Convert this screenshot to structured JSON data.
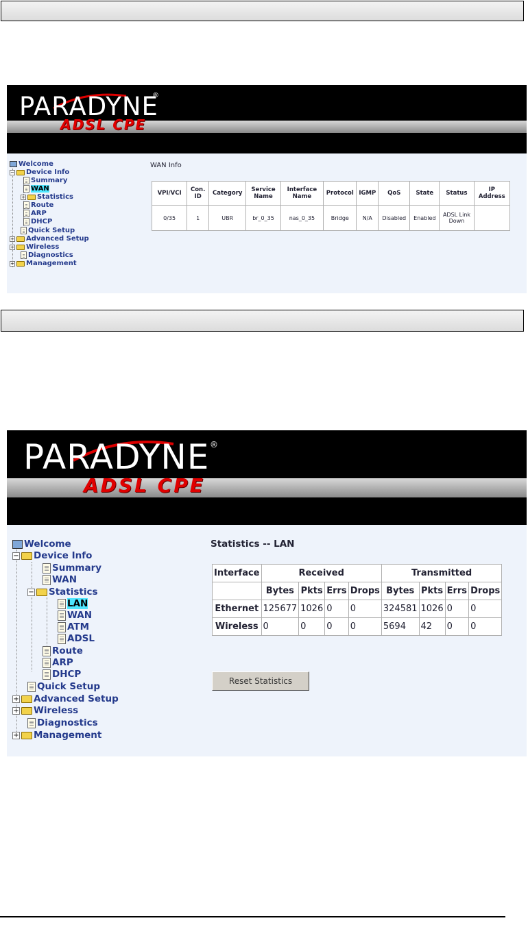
{
  "screens": [
    {
      "brand": "PARADYNE",
      "product": "ADSL CPE",
      "tree": [
        {
          "label": "Welcome"
        },
        {
          "label": "Device Info"
        },
        {
          "label": "Summary"
        },
        {
          "label": "WAN"
        },
        {
          "label": "Statistics"
        },
        {
          "label": "Route"
        },
        {
          "label": "ARP"
        },
        {
          "label": "DHCP"
        },
        {
          "label": "Quick Setup"
        },
        {
          "label": "Advanced Setup"
        },
        {
          "label": "Wireless"
        },
        {
          "label": "Diagnostics"
        },
        {
          "label": "Management"
        }
      ],
      "page_title": "WAN Info",
      "table": {
        "headers": [
          "VPI/VCI",
          "Con. ID",
          "Category",
          "Service Name",
          "Interface Name",
          "Protocol",
          "IGMP",
          "QoS",
          "State",
          "Status",
          "IP Address"
        ],
        "rows": [
          [
            "0/35",
            "1",
            "UBR",
            "br_0_35",
            "nas_0_35",
            "Bridge",
            "N/A",
            "Disabled",
            "Enabled",
            "ADSL Link Down",
            ""
          ]
        ]
      }
    },
    {
      "brand": "PARADYNE",
      "product": "ADSL CPE",
      "tree": [
        {
          "label": "Welcome"
        },
        {
          "label": "Device Info"
        },
        {
          "label": "Summary"
        },
        {
          "label": "WAN"
        },
        {
          "label": "Statistics"
        },
        {
          "label": "LAN"
        },
        {
          "label": "WAN"
        },
        {
          "label": "ATM"
        },
        {
          "label": "ADSL"
        },
        {
          "label": "Route"
        },
        {
          "label": "ARP"
        },
        {
          "label": "DHCP"
        },
        {
          "label": "Quick Setup"
        },
        {
          "label": "Advanced Setup"
        },
        {
          "label": "Wireless"
        },
        {
          "label": "Diagnostics"
        },
        {
          "label": "Management"
        }
      ],
      "page_title": "Statistics -- LAN",
      "table": {
        "group_headers": [
          "Interface",
          "Received",
          "Transmitted"
        ],
        "sub_headers": [
          "Bytes",
          "Pkts",
          "Errs",
          "Drops",
          "Bytes",
          "Pkts",
          "Errs",
          "Drops"
        ],
        "rows": [
          [
            "Ethernet",
            "125677",
            "1026",
            "0",
            "0",
            "324581",
            "1026",
            "0",
            "0"
          ],
          [
            "Wireless",
            "0",
            "0",
            "0",
            "0",
            "5694",
            "42",
            "0",
            "0"
          ]
        ]
      },
      "reset_button": "Reset Statistics"
    }
  ],
  "colors": {
    "brand_red": "#e00000",
    "tree_text": "#243a8c",
    "selected": "#4de6ff",
    "panel": "#eef3fb"
  }
}
